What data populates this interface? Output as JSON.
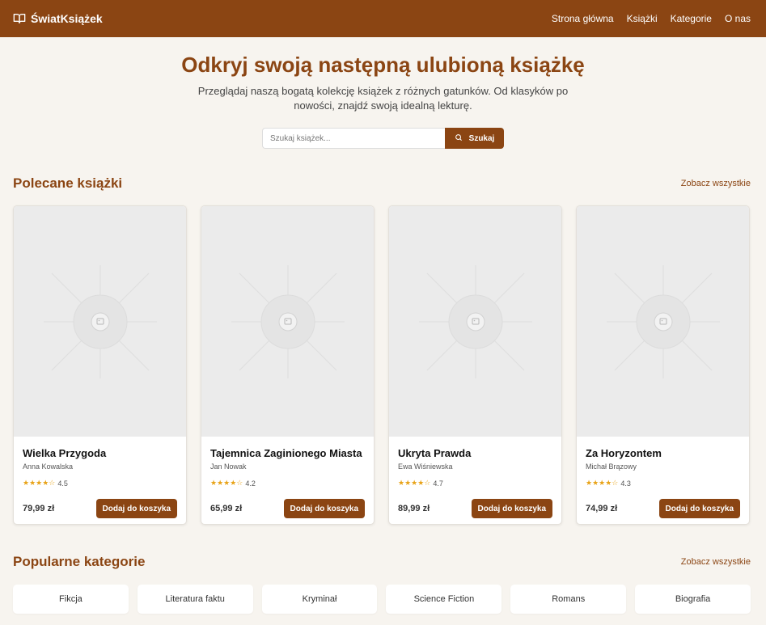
{
  "header": {
    "brand": "ŚwiatKsiążek",
    "nav": [
      {
        "label": "Strona główna"
      },
      {
        "label": "Książki"
      },
      {
        "label": "Kategorie"
      },
      {
        "label": "O nas"
      }
    ],
    "colors": {
      "primary": "#8b4513",
      "background": "#f7f4ef",
      "star": "#e8a317"
    }
  },
  "hero": {
    "title": "Odkryj swoją następną ulubioną książkę",
    "subtitle": "Przeglądaj naszą bogatą kolekcję książek z różnych gatunków. Od klasyków po nowości, znajdź swoją idealną lekturę.",
    "search_placeholder": "Szukaj książek...",
    "search_button": "Szukaj"
  },
  "featured": {
    "title": "Polecane książki",
    "see_all": "Zobacz wszystkie",
    "books": [
      {
        "title": "Wielka Przygoda",
        "author": "Anna Kowalska",
        "stars": "★★★★☆",
        "rating": "4.5",
        "price": "79,99 zł",
        "button": "Dodaj do koszyka"
      },
      {
        "title": "Tajemnica Zaginionego Miasta",
        "author": "Jan Nowak",
        "stars": "★★★★☆",
        "rating": "4.2",
        "price": "65,99 zł",
        "button": "Dodaj do koszyka"
      },
      {
        "title": "Ukryta Prawda",
        "author": "Ewa Wiśniewska",
        "stars": "★★★★☆",
        "rating": "4.7",
        "price": "89,99 zł",
        "button": "Dodaj do koszyka"
      },
      {
        "title": "Za Horyzontem",
        "author": "Michał Brązowy",
        "stars": "★★★★☆",
        "rating": "4.3",
        "price": "74,99 zł",
        "button": "Dodaj do koszyka"
      }
    ]
  },
  "categories": {
    "title": "Popularne kategorie",
    "see_all": "Zobacz wszystkie",
    "items": [
      {
        "label": "Fikcja"
      },
      {
        "label": "Literatura faktu"
      },
      {
        "label": "Kryminał"
      },
      {
        "label": "Science Fiction"
      },
      {
        "label": "Romans"
      },
      {
        "label": "Biografia"
      }
    ]
  }
}
